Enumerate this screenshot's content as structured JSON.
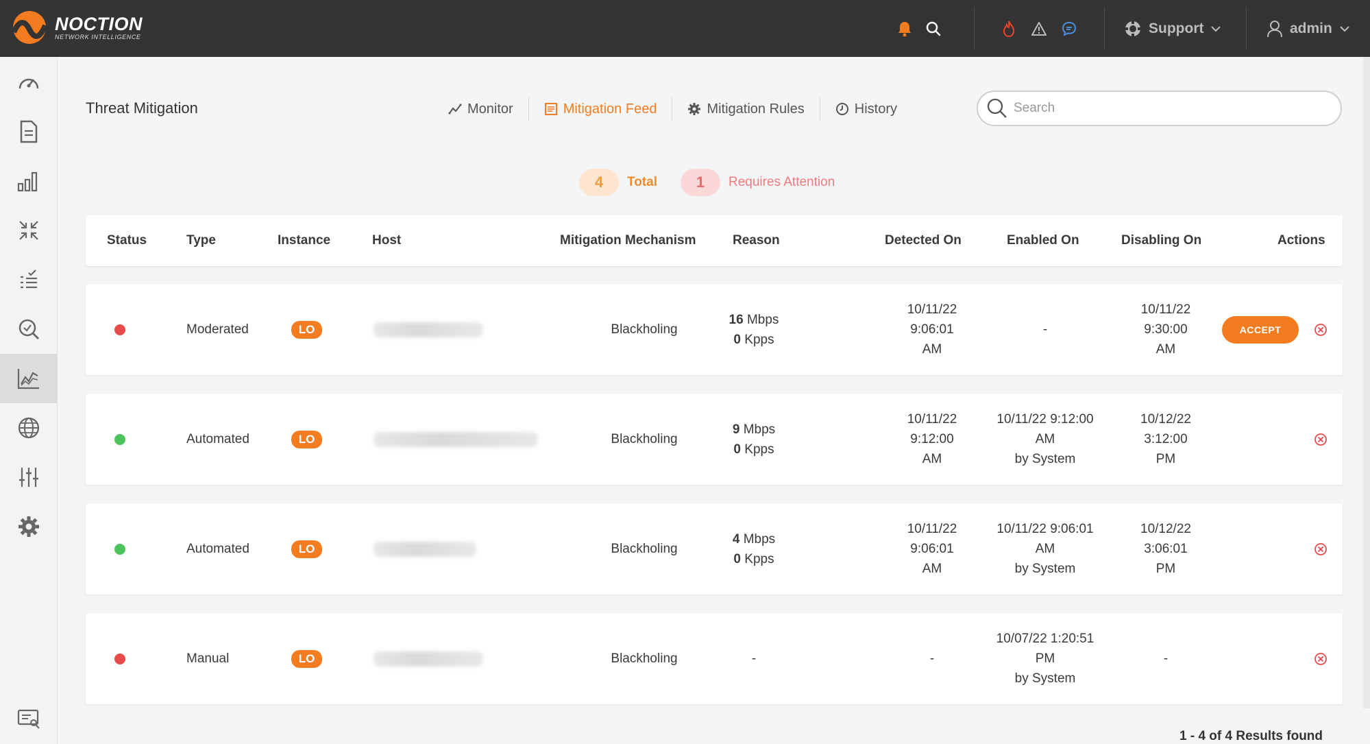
{
  "brand": {
    "name": "NOCTION",
    "tagline": "NETWORK INTELLIGENCE",
    "accent": "#f47c20"
  },
  "topbar": {
    "icons": [
      "bell-icon",
      "search-icon",
      "fire-icon",
      "warning-icon",
      "chat-icon"
    ],
    "support_label": "Support",
    "user_label": "admin"
  },
  "sidebar": {
    "items": [
      "dashboard-icon",
      "report-icon",
      "bar-chart-icon",
      "collapse-icon",
      "checklist-icon",
      "inspect-icon",
      "threat-chart-icon",
      "globe-icon",
      "sliders-icon",
      "gear-icon"
    ],
    "bottom": "help-screen-icon",
    "active_index": 6
  },
  "page": {
    "title": "Threat Mitigation"
  },
  "tabs": [
    {
      "label": "Monitor",
      "icon": "trend-icon",
      "active": false
    },
    {
      "label": "Mitigation Feed",
      "icon": "feed-icon",
      "active": true
    },
    {
      "label": "Mitigation Rules",
      "icon": "gear-icon",
      "active": false
    },
    {
      "label": "History",
      "icon": "clock-icon",
      "active": false
    }
  ],
  "search": {
    "placeholder": "Search",
    "value": ""
  },
  "summary": {
    "total_count": "4",
    "total_label": "Total",
    "attention_count": "1",
    "attention_label": "Requires Attention"
  },
  "table": {
    "headers": [
      "Status",
      "Type",
      "Instance",
      "Host",
      "Mitigation Mechanism",
      "Reason",
      "Detected On",
      "Enabled On",
      "Disabling On",
      "Actions"
    ],
    "rows": [
      {
        "status_color": "#e84b4b",
        "type": "Moderated",
        "instance": "LO",
        "mechanism": "Blackholing",
        "reason_mbps": "16",
        "reason_mbps_unit": "Mbps",
        "reason_kpps": "0",
        "reason_kpps_unit": "Kpps",
        "detected": [
          "10/11/22",
          "9:06:01",
          "AM"
        ],
        "enabled": [
          "-"
        ],
        "disabling": [
          "10/11/22",
          "9:30:00",
          "AM"
        ],
        "accept_label": "ACCEPT"
      },
      {
        "status_color": "#4cc35b",
        "type": "Automated",
        "instance": "LO",
        "mechanism": "Blackholing",
        "reason_mbps": "9",
        "reason_mbps_unit": "Mbps",
        "reason_kpps": "0",
        "reason_kpps_unit": "Kpps",
        "detected": [
          "10/11/22",
          "9:12:00",
          "AM"
        ],
        "enabled": [
          "10/11/22 9:12:00",
          "AM",
          "by System"
        ],
        "disabling": [
          "10/12/22",
          "3:12:00",
          "PM"
        ]
      },
      {
        "status_color": "#4cc35b",
        "type": "Automated",
        "instance": "LO",
        "mechanism": "Blackholing",
        "reason_mbps": "4",
        "reason_mbps_unit": "Mbps",
        "reason_kpps": "0",
        "reason_kpps_unit": "Kpps",
        "detected": [
          "10/11/22",
          "9:06:01",
          "AM"
        ],
        "enabled": [
          "10/11/22 9:06:01",
          "AM",
          "by System"
        ],
        "disabling": [
          "10/12/22",
          "3:06:01",
          "PM"
        ]
      },
      {
        "status_color": "#e84b4b",
        "type": "Manual",
        "instance": "LO",
        "mechanism": "Blackholing",
        "reason_dash": "-",
        "detected": [
          "-"
        ],
        "enabled": [
          "10/07/22 1:20:51",
          "PM",
          "by System"
        ],
        "disabling": [
          "-"
        ]
      }
    ]
  },
  "results_text": "1 - 4 of 4 Results found"
}
